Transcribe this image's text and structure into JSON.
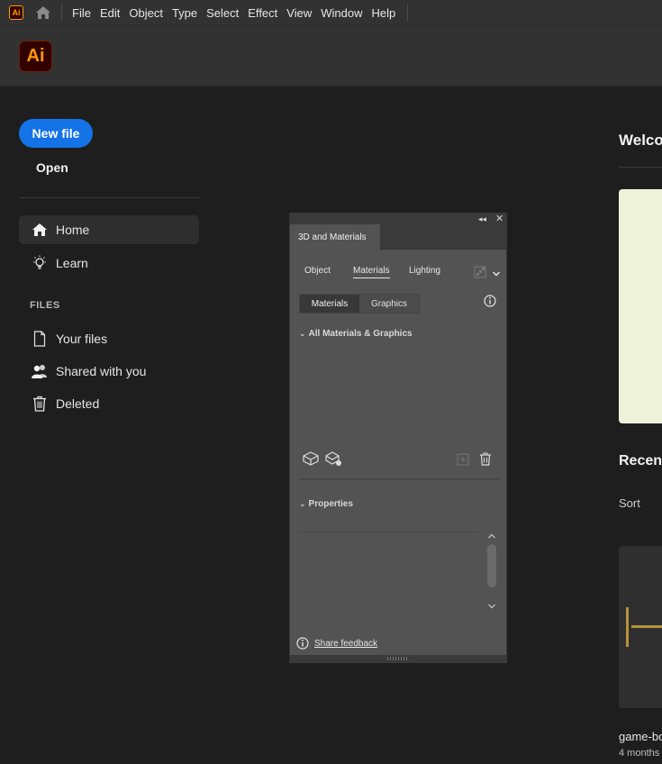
{
  "menubar": {
    "app_mini": "Ai",
    "items": [
      "File",
      "Edit",
      "Object",
      "Type",
      "Select",
      "Effect",
      "View",
      "Window",
      "Help"
    ]
  },
  "header": {
    "logo": "Ai"
  },
  "sidebar": {
    "new_file": "New file",
    "open": "Open",
    "nav": [
      {
        "label": "Home",
        "icon": "home-icon",
        "active": true
      },
      {
        "label": "Learn",
        "icon": "lightbulb-icon",
        "active": false
      }
    ],
    "files_label": "FILES",
    "files": [
      {
        "label": "Your files",
        "icon": "file-icon"
      },
      {
        "label": "Shared with you",
        "icon": "shared-users-icon"
      },
      {
        "label": "Deleted",
        "icon": "trash-icon"
      }
    ]
  },
  "main": {
    "welcome": "Welcome",
    "recent": "Recent",
    "sort": "Sort",
    "recent_file": {
      "name": "game-bo",
      "date": "4 months"
    },
    "banner_color": "#eef2d8"
  },
  "panel": {
    "title": "3D and Materials",
    "tabs": [
      "Object",
      "Materials",
      "Lighting"
    ],
    "selected_tab": "Materials",
    "chips": [
      "Materials",
      "Graphics"
    ],
    "selected_chip": "Materials",
    "section_materials": "All Materials & Graphics",
    "section_properties": "Properties",
    "feedback": "Share feedback"
  },
  "colors": {
    "accent": "#1473e6",
    "brand": "#ff9a00",
    "brand_bg": "#330000"
  }
}
